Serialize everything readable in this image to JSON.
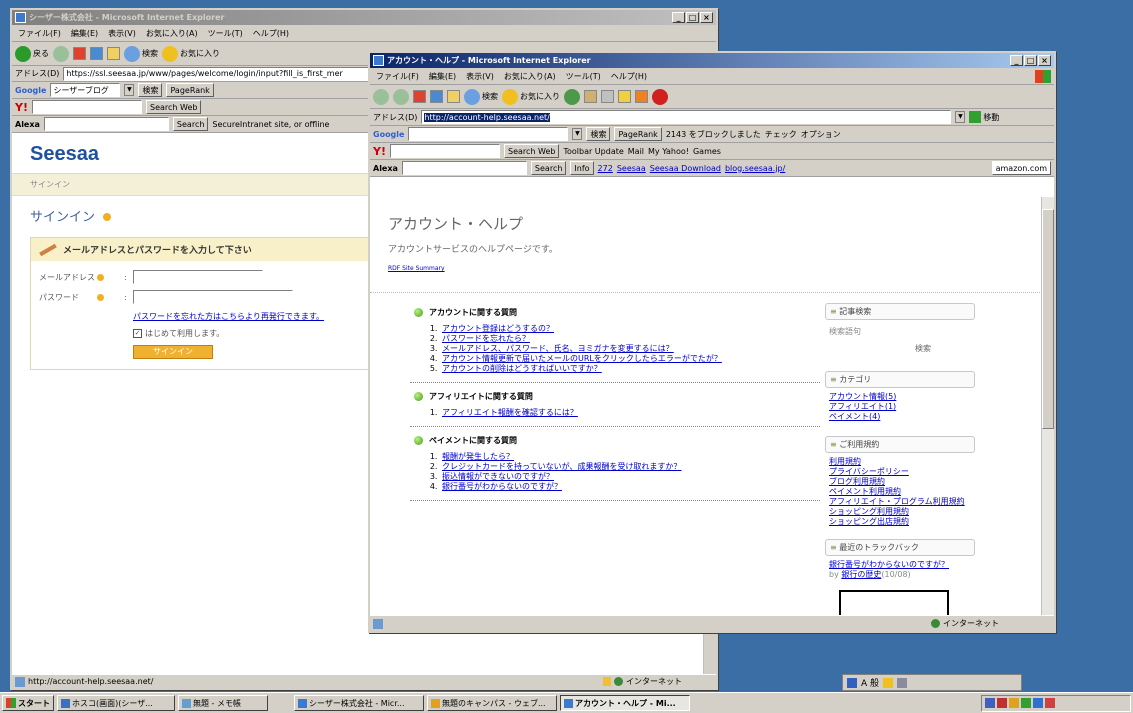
{
  "back_window": {
    "title": "シーザー株式会社 - Microsoft Internet Explorer",
    "menu": [
      "ファイル(F)",
      "編集(E)",
      "表示(V)",
      "お気に入り(A)",
      "ツール(T)",
      "ヘルプ(H)"
    ],
    "toolbar": {
      "back": "戻る",
      "search": "検索",
      "favorites": "お気に入り"
    },
    "address_label": "アドレス(D)",
    "address_value": "https://ssl.seesaa.jp/www/pages/welcome/login/input?fill_is_first_mer",
    "google_field": "シーザーブログ",
    "google_search": "検索",
    "pagerank": "PageRank",
    "yahoo_search": "Search Web",
    "alexa_label": "Alexa",
    "alexa_search": "Search",
    "alexa_text": "SecureIntranet site, or offline",
    "logo": "Seesaa",
    "breadcrumb": "サインイン",
    "heading": "サインイン",
    "instruction": "メールアドレスとパスワードを入力して下さい",
    "email_label": "メールアドレス",
    "password_label": "パスワード",
    "colon": ":",
    "forgot_link": "パスワードを忘れた方はこちらより再発行できます。",
    "first_time_label": "はじめて利用します。",
    "signin_button": "サインイン",
    "status_url": "http://account-help.seesaa.net/",
    "status_zone": "インターネット"
  },
  "front_window": {
    "title": "アカウント・ヘルプ - Microsoft Internet Explorer",
    "menu": [
      "ファイル(F)",
      "編集(E)",
      "表示(V)",
      "お気に入り(A)",
      "ツール(T)",
      "ヘルプ(H)"
    ],
    "toolbar": {
      "search": "検索",
      "favorites": "お気に入り"
    },
    "address_label": "アドレス(D)",
    "address_value": "http://account-help.seesaa.net/",
    "go_button": "移動",
    "google_search": "検索",
    "pagerank": "PageRank",
    "popup_blocked": "2143 をブロックしました",
    "check": "チェック",
    "options": "オプション",
    "yahoo_search": "Search Web",
    "toolbar_update": "Toolbar Update",
    "mail": "Mail",
    "my_yahoo": "My Yahoo!",
    "games": "Games",
    "alexa_label": "Alexa",
    "alexa_search": "Search",
    "alexa_info": "Info",
    "alexa_rank": "272",
    "links": [
      "Seesaa",
      "Seesaa Download",
      "blog.seesaa.jp/"
    ],
    "amazon": "amazon.com",
    "page_title": "アカウント・ヘルプ",
    "page_subtitle": "アカウントサービスのヘルプページです。",
    "rdf_link": "RDF Site Summary",
    "sections": [
      {
        "heading": "アカウントに関する質問",
        "items": [
          "アカウント登録はどうするの？",
          "パスワードを忘れたら？",
          "メールアドレス、パスワード、氏名、ヨミガナを変更するには？",
          "アカウント情報更新で届いたメールのURLをクリックしたらエラーがでたが？",
          "アカウントの削除はどうすればいいですか？"
        ]
      },
      {
        "heading": "アフィリエイトに関する質問",
        "items": [
          "アフィリエイト報酬を確認するには？"
        ]
      },
      {
        "heading": "ペイメントに関する質問",
        "items": [
          "報酬が発生したら？",
          "クレジットカードを持っていないが、成果報酬を受け取れますか？",
          "振込情報ができないのですが？",
          "銀行番号がわからないのですが？"
        ]
      }
    ],
    "sidebar": {
      "search_title": "記事検索",
      "search_label": "検索語句",
      "search_button": "検索",
      "category_title": "カテゴリ",
      "categories": [
        "アカウント情報(5)",
        "アフィリエイト(1)",
        "ペイメント(4)"
      ],
      "terms_title": "ご利用規約",
      "terms": [
        "利用規約",
        "プライバシーポリシー",
        "ブログ利用規約",
        "ペイメント利用規約",
        "アフィリエイト・プログラム利用規約",
        "ショッピング利用規約",
        "ショッピング出店規約"
      ],
      "trackback_title": "最近のトラックバック",
      "trackback_link": "銀行番号がわからないのですが？",
      "trackback_by": "by",
      "trackback_source": "銀行の歴史",
      "trackback_date": "(10/08)"
    },
    "status_zone": "インターネット"
  },
  "taskbar": {
    "start": "スタート",
    "tasks": [
      "ホスコ(画面)(シーザ...",
      "無題 - メモ帳",
      "シーザー株式会社 - Micr...",
      "無題のキャンパス - ウェブ...",
      "アカウント・ヘルプ - Mi..."
    ],
    "ime": "A 般"
  }
}
